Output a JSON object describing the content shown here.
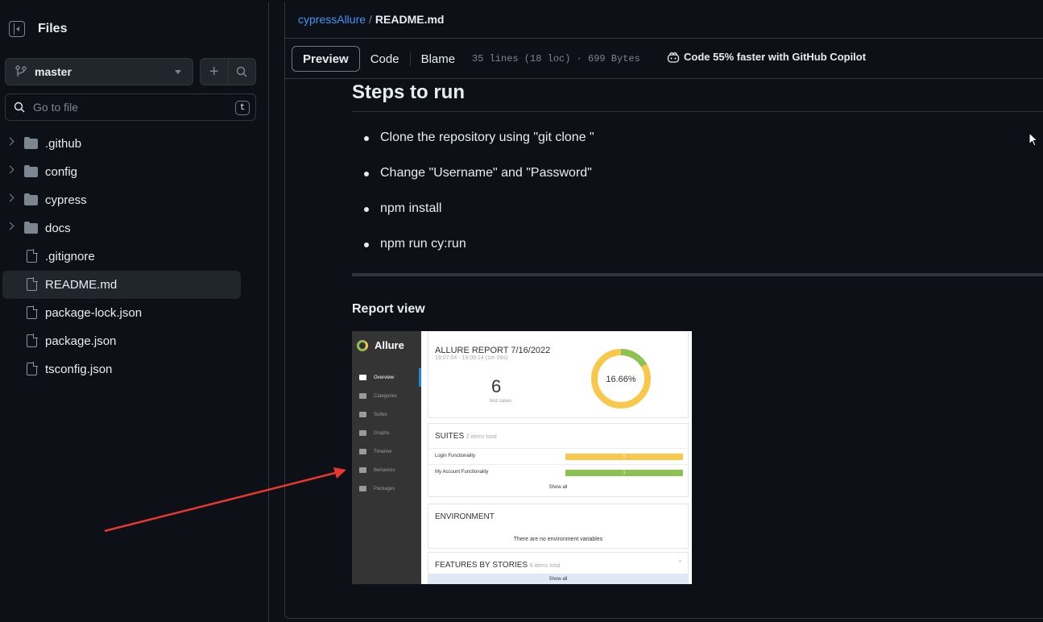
{
  "sidebar": {
    "title": "Files",
    "branch": "master",
    "search_placeholder": "Go to file",
    "search_shortcut": "t",
    "items": [
      {
        "type": "folder",
        "name": ".github"
      },
      {
        "type": "folder",
        "name": "config"
      },
      {
        "type": "folder",
        "name": "cypress"
      },
      {
        "type": "folder",
        "name": "docs"
      },
      {
        "type": "file",
        "name": ".gitignore"
      },
      {
        "type": "file",
        "name": "README.md",
        "selected": true
      },
      {
        "type": "file",
        "name": "package-lock.json"
      },
      {
        "type": "file",
        "name": "package.json"
      },
      {
        "type": "file",
        "name": "tsconfig.json"
      }
    ]
  },
  "header": {
    "repo": "cypressAllure",
    "separator": "/",
    "file": "README.md"
  },
  "toolbar": {
    "tabs": [
      "Preview",
      "Code",
      "Blame"
    ],
    "active_tab": "Preview",
    "meta": "35 lines (18 loc) · 699 Bytes",
    "copilot": "Code 55% faster with GitHub Copilot"
  },
  "readme": {
    "heading": "Steps to run",
    "steps": [
      "Clone the repository using \"git clone \"",
      "Change \"Username\" and \"Password\"",
      "npm install",
      "npm run cy:run"
    ],
    "subheading": "Report view"
  },
  "allure": {
    "logo": "Allure",
    "nav": [
      "Overview",
      "Categories",
      "Suites",
      "Graphs",
      "Timeline",
      "Behaviors",
      "Packages"
    ],
    "report_title": "ALLURE REPORT 7/16/2022",
    "report_time": "19:07:04 - 19:08:14 (1m 09s)",
    "test_count": "6",
    "test_count_label": "test cases",
    "pass_percent": "16.66%",
    "pass_fraction": 0.1666,
    "suites_title": "SUITES",
    "suites_sub": "2 items total",
    "suites": [
      {
        "name": "Login Functionality",
        "value": "5",
        "color": "#f9c84b"
      },
      {
        "name": "My Account Functionality",
        "value": "1",
        "color": "#8dc152"
      }
    ],
    "show_all": "Show all",
    "env_title": "ENVIRONMENT",
    "env_text": "There are no environment variables",
    "features_title": "FEATURES BY STORIES",
    "features_sub": "6 items total"
  },
  "colors": {
    "link": "#4493f8",
    "arrow": "#e5392f",
    "passed": "#8dc152",
    "failed": "#f9c84b"
  }
}
